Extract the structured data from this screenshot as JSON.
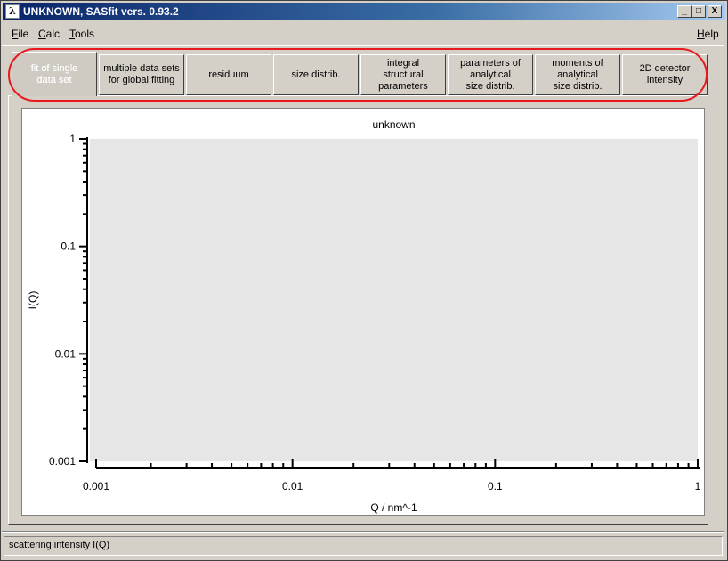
{
  "window": {
    "title": "UNKNOWN, SASfit vers. 0.93.2",
    "app_icon_glyph": "λ",
    "controls": {
      "minimize": "_",
      "maximize": "□",
      "close": "X"
    }
  },
  "menu": {
    "file": {
      "mnemonic": "F",
      "rest": "ile"
    },
    "calc": {
      "mnemonic": "C",
      "rest": "alc"
    },
    "tools": {
      "mnemonic": "T",
      "rest": "ools"
    },
    "help": {
      "mnemonic": "H",
      "rest": "elp"
    }
  },
  "tabs": [
    {
      "label": "fit of single\ndata set",
      "active": true
    },
    {
      "label": "multiple data sets\nfor global fitting",
      "active": false
    },
    {
      "label": "residuum",
      "active": false
    },
    {
      "label": "size distrib.",
      "active": false
    },
    {
      "label": "integral\nstructural\nparameters",
      "active": false
    },
    {
      "label": "parameters of\nanalytical\nsize distrib.",
      "active": false
    },
    {
      "label": "moments of\nanalytical\nsize distrib.",
      "active": false
    },
    {
      "label": "2D detector\nintensity",
      "active": false
    }
  ],
  "highlight_color": "#e8181e",
  "chart_data": {
    "type": "scatter",
    "title": "unknown",
    "xlabel": "Q / nm^-1",
    "ylabel": "I(Q)",
    "xscale": "log",
    "yscale": "log",
    "xlim": [
      0.001,
      1
    ],
    "ylim": [
      0.001,
      1
    ],
    "x_ticks": [
      "0.001",
      "0.01",
      "0.1",
      "1"
    ],
    "y_ticks": [
      "1",
      "0.1",
      "0.01",
      "0.001"
    ],
    "plot_background": "#e6e6e6",
    "series": []
  },
  "status": {
    "text": "scattering intensity I(Q)"
  }
}
